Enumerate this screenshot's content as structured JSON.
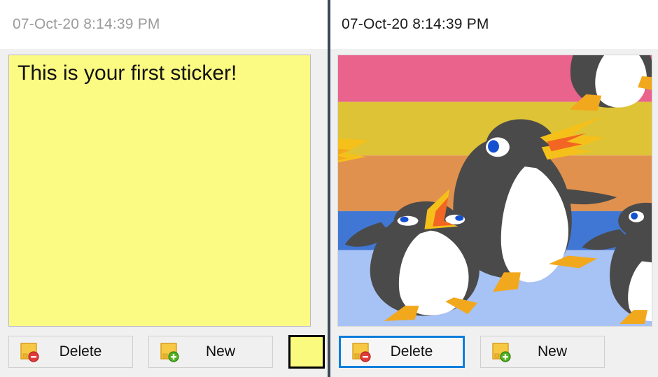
{
  "app": {
    "name": "Stickies",
    "window_divider_color": "#3c4a57"
  },
  "windows": [
    {
      "id": "left",
      "state": "inactive",
      "timestamp": "07-Oct-20 8:14:39 PM",
      "sticker": {
        "kind": "text",
        "text": "This is your first sticker!",
        "background_color": "#fbfb83",
        "border_color": "#b9b9c4"
      },
      "toolbar": {
        "delete_label": "Delete",
        "new_label": "New",
        "delete_icon": "note-minus-icon",
        "new_icon": "note-plus-icon",
        "color_swatch": {
          "name": "color-swatch",
          "color": "#fafa7e",
          "border_color": "#000000"
        }
      }
    },
    {
      "id": "right",
      "state": "active",
      "timestamp": "07-Oct-20 8:14:39 PM",
      "sticker": {
        "kind": "image",
        "image_name": "penguins-on-striped-background",
        "description": "Cartoon penguins over horizontal color bands",
        "bands": [
          {
            "name": "pink",
            "color": "#e9638d"
          },
          {
            "name": "gold",
            "color": "#ddc335"
          },
          {
            "name": "orange",
            "color": "#e1914e"
          },
          {
            "name": "blue",
            "color": "#4077d4"
          },
          {
            "name": "light-blue",
            "color": "#a7c2f4"
          }
        ],
        "penguin_colors": {
          "body": "#4a4a4a",
          "belly": "#ffffff",
          "beak": "#f6b41b",
          "beak_accent": "#f26522",
          "eye": "#1450d0",
          "eye_white": "#ffffff",
          "feet": "#f2a81d"
        }
      },
      "toolbar": {
        "delete_label": "Delete",
        "new_label": "New",
        "delete_icon": "note-minus-icon",
        "new_icon": "note-plus-icon",
        "focus_color": "#0d7ddb",
        "focused_button": "delete"
      }
    }
  ]
}
